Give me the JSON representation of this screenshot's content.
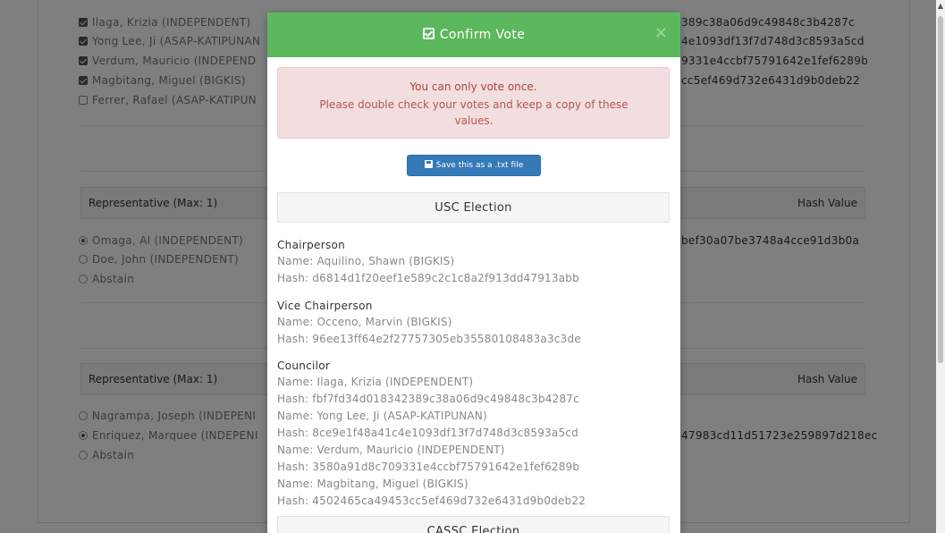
{
  "background": {
    "top_options": [
      {
        "label": "Ilaga, Krizia (INDEPENDENT)",
        "checked": true
      },
      {
        "label": "Yong Lee, Ji (ASAP-KATIPUNAN",
        "checked": true
      },
      {
        "label": "Verdum, Mauricio (INDEPEND",
        "checked": true
      },
      {
        "label": "Magbitang, Miguel (BIGKIS)",
        "checked": true
      },
      {
        "label": "Ferrer, Rafael (ASAP-KATIPUN",
        "checked": false
      }
    ],
    "top_hashes": [
      "389c38a06d9c49848c3b4287c",
      "4e1093df13f7d748d3c8593a5cd",
      "9331e4ccbf75791642e1fef6289b",
      "cc5ef469d732e6431d9b0deb22"
    ],
    "section1": {
      "title": "Representative (Max: 1)",
      "hash_header": "Hash Value",
      "options": [
        {
          "label": "Omaga, Al (INDEPENDENT)",
          "selected": true
        },
        {
          "label": "Doe, John (INDEPENDENT)",
          "selected": false
        },
        {
          "label": "Abstain",
          "selected": false
        }
      ],
      "hash": "bef30a07be3748a4cce91d3b0a"
    },
    "section2": {
      "title": "Representative (Max: 1)",
      "hash_header": "Hash Value",
      "options": [
        {
          "label": "Nagrampa, Joseph (INDEPENI",
          "selected": false
        },
        {
          "label": "Enriquez, Marquee (INDEPENI",
          "selected": true
        },
        {
          "label": "Abstain",
          "selected": false
        }
      ],
      "hash": "47983cd11d51723e259897d218ec"
    }
  },
  "modal": {
    "title": "Confirm Vote",
    "close_symbol": "×",
    "alert_line1": "You can only vote once.",
    "alert_line2": "Please double check your votes and keep a copy of these values.",
    "save_button": "Save this as a .txt file",
    "elections": [
      {
        "name": "USC Election"
      },
      {
        "name": "CASSC Election"
      }
    ],
    "positions": [
      {
        "title": "Chairperson",
        "lines": [
          "Name: Aquilino, Shawn (BIGKIS)",
          "Hash: d6814d1f20eef1e589c2c1c8a2f913dd47913abb"
        ]
      },
      {
        "title": "Vice Chairperson",
        "lines": [
          "Name: Occeno, Marvin (BIGKIS)",
          "Hash: 96ee13ff64e2f27757305eb35580108483a3c3de"
        ]
      },
      {
        "title": "Councilor",
        "lines": [
          "Name: Ilaga, Krizia (INDEPENDENT)",
          "Hash: fbf7fd34d018342389c38a06d9c49848c3b4287c",
          "Name: Yong Lee, Ji (ASAP-KATIPUNAN)",
          "Hash: 8ce9e1f48a41c4e1093df13f7d748d3c8593a5cd",
          "Name: Verdum, Mauricio (INDEPENDENT)",
          "Hash: 3580a91d8c709331e4ccbf75791642e1fef6289b",
          "Name: Magbitang, Miguel (BIGKIS)",
          "Hash: 4502465ca49453cc5ef469d732e6431d9b0deb22"
        ]
      }
    ]
  }
}
